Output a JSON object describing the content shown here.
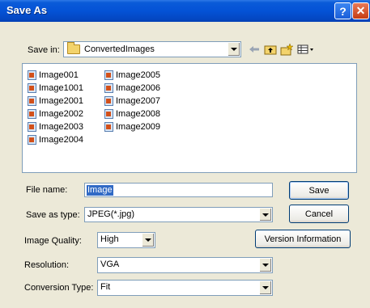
{
  "window": {
    "title": "Save As",
    "help_glyph": "?",
    "close_glyph": "✕"
  },
  "save_in": {
    "label": "Save in:",
    "value": "ConvertedImages"
  },
  "toolbar": {
    "back_icon": "back-arrow-icon",
    "up_icon": "up-folder-icon",
    "new_folder_icon": "new-folder-icon",
    "views_icon": "views-menu-icon"
  },
  "files": {
    "column1": [
      "Image001",
      "Image1001",
      "Image2001",
      "Image2002",
      "Image2003",
      "Image2004"
    ],
    "column2": [
      "Image2005",
      "Image2006",
      "Image2007",
      "Image2008",
      "Image2009"
    ]
  },
  "file_name": {
    "label": "File name:",
    "value": "Image"
  },
  "save_as_type": {
    "label": "Save as type:",
    "value": "JPEG(*.jpg)"
  },
  "image_quality": {
    "label": "Image Quality:",
    "value": "High"
  },
  "resolution": {
    "label": "Resolution:",
    "value": "VGA"
  },
  "conversion_type": {
    "label": "Conversion Type:",
    "value": "Fit"
  },
  "buttons": {
    "save": "Save",
    "cancel": "Cancel",
    "version_info": "Version Information"
  },
  "colors": {
    "titlebar": "#0452D6",
    "dialog_bg": "#ECE9D8",
    "selection": "#316AC5",
    "field_border": "#7F9DB9"
  }
}
